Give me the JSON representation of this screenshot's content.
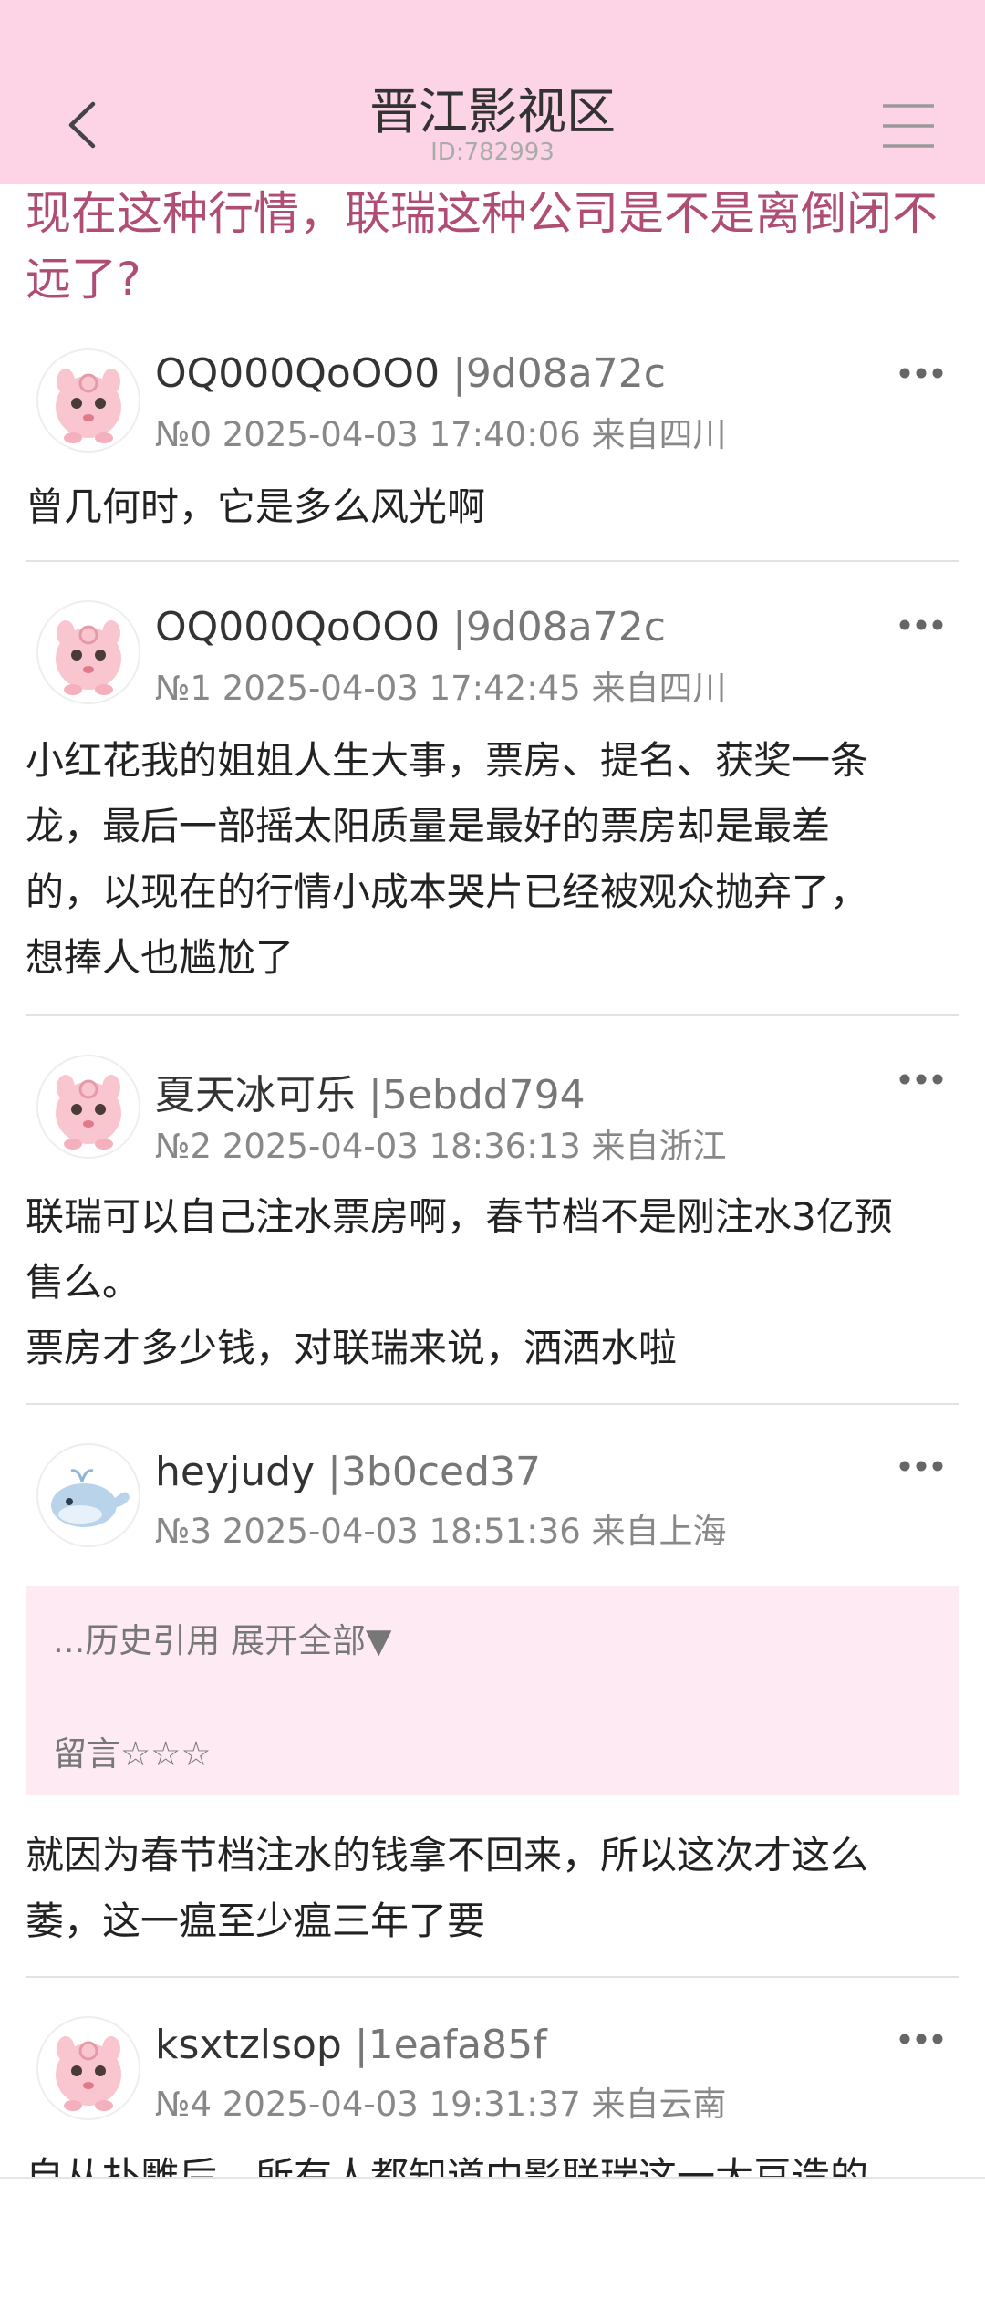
{
  "header": {
    "title": "晋江影视区",
    "id_text": "ID:782993"
  },
  "thread": {
    "title": "现在这种行情，联瑞这种公司是不是离倒闭不远了?"
  },
  "posts": [
    {
      "username": "OQ000QoOO0",
      "user_id": "|9d08a72c",
      "meta": "№0 2025-04-03 17:40:06 来自四川",
      "avatar": "pink-puff-avatar",
      "body": [
        "曾几何时，它是多么风光啊"
      ]
    },
    {
      "username": "OQ000QoOO0",
      "user_id": "|9d08a72c",
      "meta": "№1 2025-04-03 17:42:45 来自四川",
      "avatar": "pink-puff-avatar",
      "body": [
        "小红花我的姐姐人生大事，票房、提名、获奖一条",
        "龙，最后一部摇太阳质量是最好的票房却是最差",
        "的，以现在的行情小成本哭片已经被观众抛弃了，",
        "想捧人也尴尬了"
      ]
    },
    {
      "username": "夏天冰可乐",
      "user_id": "|5ebdd794",
      "meta": "№2 2025-04-03 18:36:13 来自浙江",
      "avatar": "pink-puff-avatar",
      "body": [
        "联瑞可以自己注水票房啊，春节档不是刚注水3亿预",
        "售么。",
        "票房才多少钱，对联瑞来说，洒洒水啦"
      ]
    },
    {
      "username": "heyjudy",
      "user_id": "|3b0ced37",
      "meta": "№3 2025-04-03 18:51:36 来自上海",
      "avatar": "blue-whale-avatar",
      "quote": {
        "expand_text": "...历史引用 展开全部▼",
        "quote_text": "留言☆☆☆"
      },
      "body": [
        "就因为春节档注水的钱拿不回来，所以这次才这么",
        "萎，这一瘟至少瘟三年了要"
      ]
    },
    {
      "username": "ksxtzlsop",
      "user_id": "|1eafa85f",
      "meta": "№4 2025-04-03 19:31:37 来自云南",
      "avatar": "pink-puff-avatar",
      "body": [
        "自从扑雕后，所有人都知道中影联瑞这一大豆造的"
      ]
    }
  ],
  "colors": {
    "header_bg": "#fcd4e6",
    "title_color": "#b04d74",
    "quote_bg": "#fdeaf3"
  }
}
